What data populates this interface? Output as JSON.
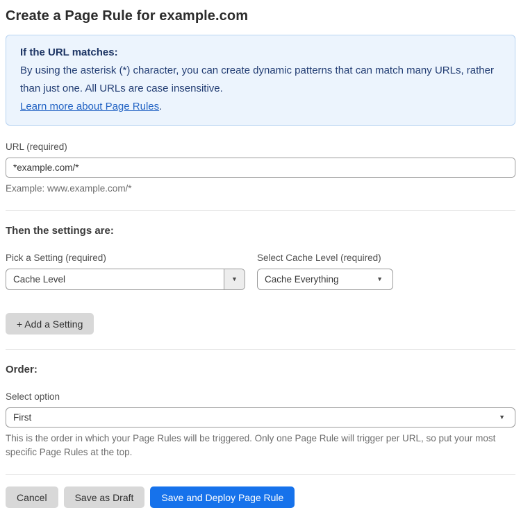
{
  "page": {
    "title": "Create a Page Rule for example.com"
  },
  "info_box": {
    "heading": "If the URL matches:",
    "body": "By using the asterisk (*) character, you can create dynamic patterns that can match many URLs, rather than just one. All URLs are case insensitive.",
    "link_label": "Learn more about Page Rules",
    "link_suffix": "."
  },
  "url_field": {
    "label": "URL (required)",
    "value": "*example.com/*",
    "example": "Example: www.example.com/*"
  },
  "settings_section": {
    "heading": "Then the settings are:",
    "setting_picker": {
      "label": "Pick a Setting (required)",
      "value": "Cache Level"
    },
    "cache_picker": {
      "label": "Select Cache Level (required)",
      "value": "Cache Everything"
    },
    "add_setting_label": "+ Add a Setting"
  },
  "order_section": {
    "heading": "Order:",
    "select_label": "Select option",
    "value": "First",
    "help_text": "This is the order in which your Page Rules will be triggered. Only one Page Rule will trigger per URL, so put your most specific Page Rules at the top."
  },
  "actions": {
    "cancel_label": "Cancel",
    "save_draft_label": "Save as Draft",
    "save_deploy_label": "Save and Deploy Page Rule"
  },
  "icons": {
    "caret_down": "▼"
  },
  "colors": {
    "accent_blue": "#1672eb",
    "info_bg": "#ecf4fd",
    "info_border": "#b7d3f1",
    "info_text": "#223d73",
    "link_blue": "#2263c4",
    "button_gray": "#d8d8d8"
  }
}
